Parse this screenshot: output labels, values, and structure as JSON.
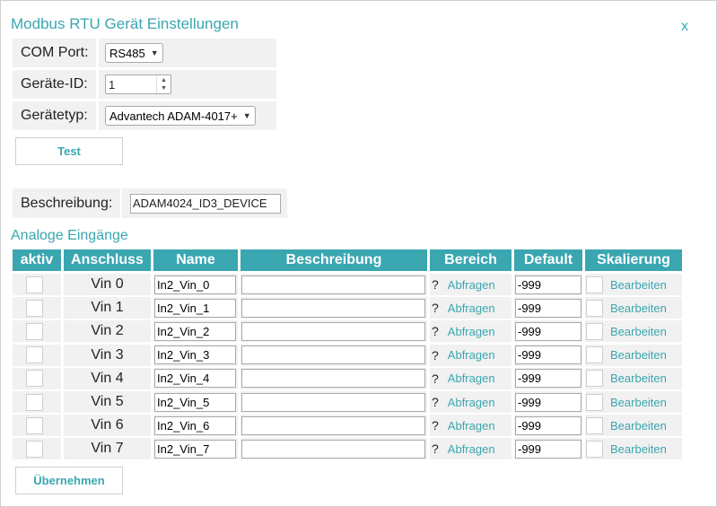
{
  "dialog": {
    "title": "Modbus RTU Gerät Einstellungen",
    "close_label": "x"
  },
  "config": {
    "com_port_label": "COM Port:",
    "com_port_value": "RS485",
    "device_id_label": "Geräte-ID:",
    "device_id_value": "1",
    "device_type_label": "Gerätetyp:",
    "device_type_value": "Advantech ADAM-4017+",
    "test_button": "Test",
    "description_label": "Beschreibung:",
    "description_value": "ADAM4024_ID3_DEVICE"
  },
  "analog": {
    "section_title": "Analoge Eingänge",
    "headers": [
      "aktiv",
      "Anschluss",
      "Name",
      "Beschreibung",
      "Bereich",
      "Default",
      "Skalierung"
    ],
    "query_mark": "?",
    "query_label": "Abfragen",
    "edit_label": "Bearbeiten",
    "rows": [
      {
        "port": "Vin 0",
        "name": "In2_Vin_0",
        "description": "",
        "default": "-999"
      },
      {
        "port": "Vin 1",
        "name": "In2_Vin_1",
        "description": "",
        "default": "-999"
      },
      {
        "port": "Vin 2",
        "name": "In2_Vin_2",
        "description": "",
        "default": "-999"
      },
      {
        "port": "Vin 3",
        "name": "In2_Vin_3",
        "description": "",
        "default": "-999"
      },
      {
        "port": "Vin 4",
        "name": "In2_Vin_4",
        "description": "",
        "default": "-999"
      },
      {
        "port": "Vin 5",
        "name": "In2_Vin_5",
        "description": "",
        "default": "-999"
      },
      {
        "port": "Vin 6",
        "name": "In2_Vin_6",
        "description": "",
        "default": "-999"
      },
      {
        "port": "Vin 7",
        "name": "In2_Vin_7",
        "description": "",
        "default": "-999"
      }
    ],
    "apply_button": "Übernehmen"
  },
  "colors": {
    "accent": "#3aa6b0",
    "cell_background": "#f1f1f1",
    "header_text": "#ffffff"
  }
}
